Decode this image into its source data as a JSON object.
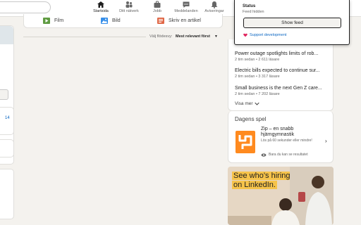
{
  "nav": {
    "items": [
      {
        "label": "Startsida",
        "icon": "home-icon",
        "active": true
      },
      {
        "label": "Ditt nätverk",
        "icon": "people-icon",
        "active": false
      },
      {
        "label": "Jobb",
        "icon": "briefcase-icon",
        "active": false
      },
      {
        "label": "Meddelanden",
        "icon": "chat-icon",
        "active": false
      },
      {
        "label": "Aviseringar",
        "icon": "bell-icon",
        "active": false
      }
    ]
  },
  "left": {
    "count": "14"
  },
  "share": {
    "items": [
      {
        "label": "Film",
        "icon": "video-icon",
        "color": "#5f9b41"
      },
      {
        "label": "Bild",
        "icon": "image-icon",
        "color": "#378fe9"
      },
      {
        "label": "Skriv en artikel",
        "icon": "article-icon",
        "color": "#e06847"
      }
    ]
  },
  "sort": {
    "label": "Välj flödesvy:",
    "value": "Mest relevant först"
  },
  "news": {
    "items": [
      {
        "title": "Power outage spotlights limits of rob...",
        "meta": "2 tim sedan • 2 611 läsare"
      },
      {
        "title": "Electric bills expected to continue sur...",
        "meta": "2 tim sedan • 3 317 läsare"
      },
      {
        "title": "Small business is the next Gen Z care...",
        "meta": "2 tim sedan • 7 202 läsare"
      }
    ],
    "show_more": "Visa mer"
  },
  "games": {
    "title": "Dagens spel",
    "name": "Zip – en snabb hjärngymnastik",
    "description": "Lös på 60 sekunder eller mindre!",
    "footer": "Bara du kan se resultatet"
  },
  "ad": {
    "line1": "See who’s hiring",
    "line2": "on LinkedIn."
  },
  "dropdown": {
    "status_label": "Status",
    "status_value": "Feed hidden",
    "button": "Show feed",
    "support": "Support development"
  },
  "colors": {
    "accent": "#0a66c2",
    "background": "#f4f2ee",
    "game_orange": "#ff8a1f",
    "ad_highlight": "#f6c34a"
  }
}
